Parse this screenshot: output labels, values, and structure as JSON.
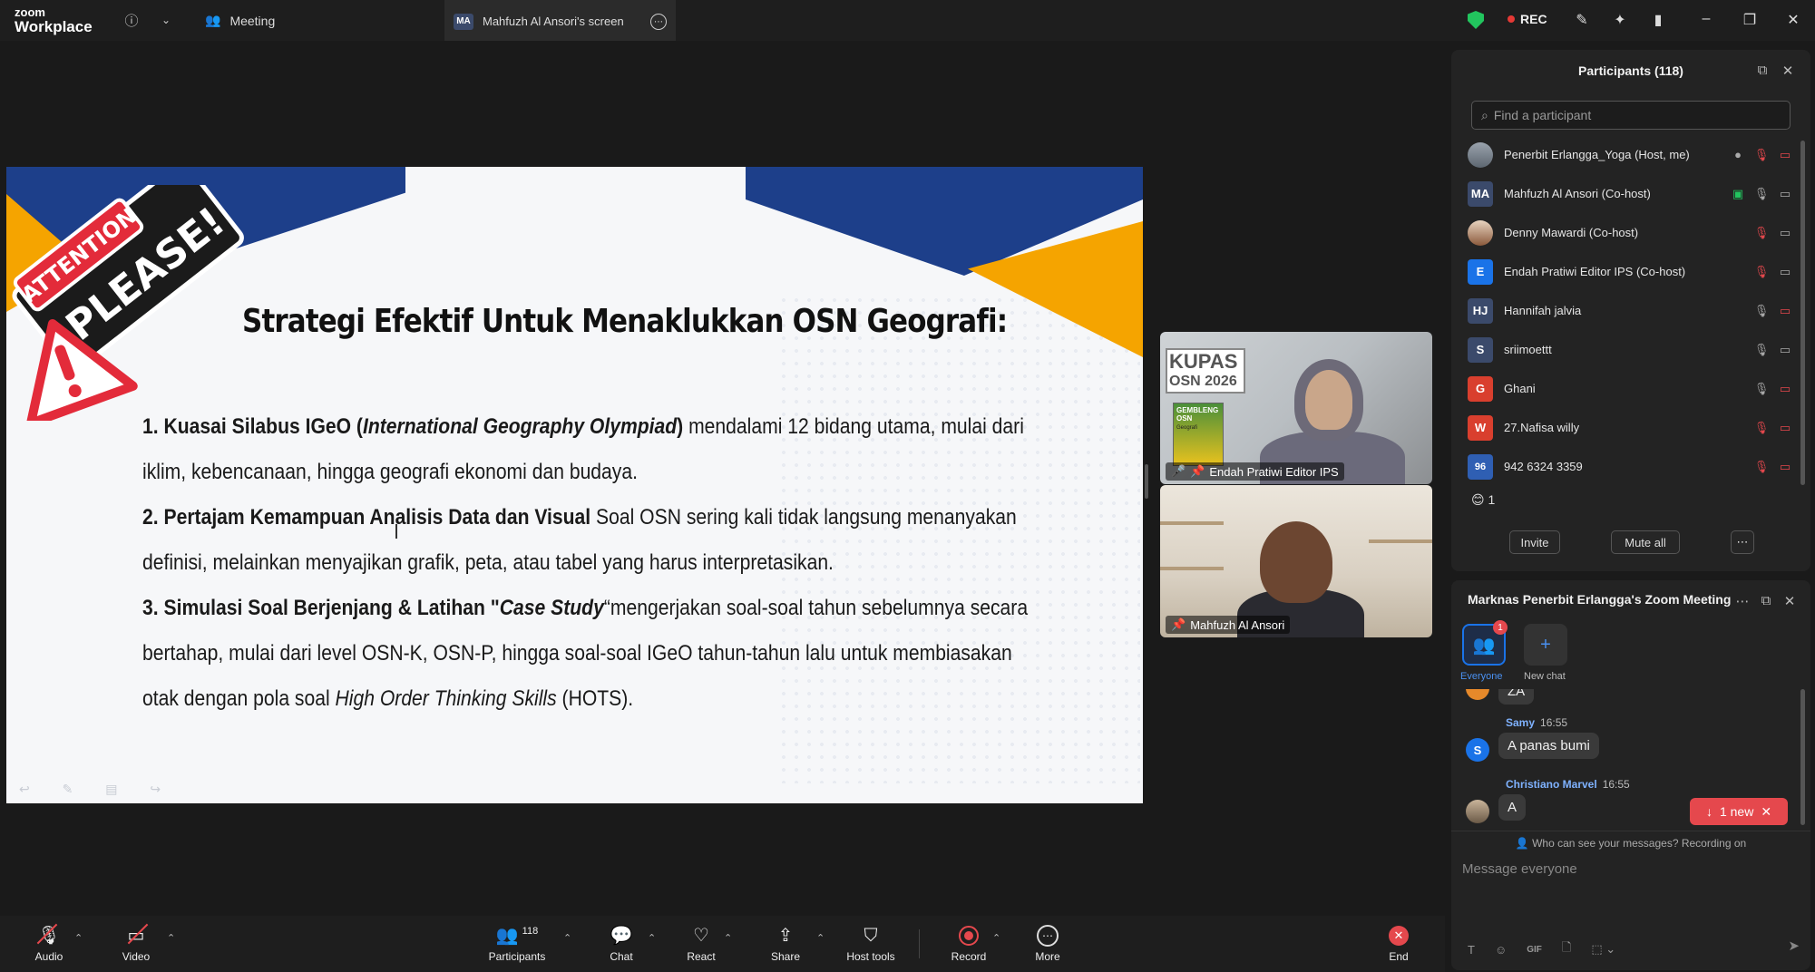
{
  "app": {
    "logo_line1": "zoom",
    "logo_line2": "Workplace"
  },
  "tabs": {
    "meeting": "Meeting",
    "screen_badge": "MA",
    "screen": "Mahfuzh Al Ansori's screen"
  },
  "status": {
    "rec": "REC"
  },
  "slide": {
    "attention_line1": "ATTENTION",
    "attention_line2": "PLEASE!",
    "title": "Strategi Efektif Untuk Menaklukkan OSN Geografi:",
    "items": [
      {
        "num": "1.",
        "bold": "Kuasai Silabus IGeO (",
        "italic_bold": "International Geography Olympiad",
        "bold_end": ")",
        "text": " mendalami 12 bidang utama, mulai dari iklim, kebencanaan, hingga geografi ekonomi dan budaya."
      },
      {
        "num": "2.",
        "bold": "Pertajam Kemampuan Analisis Data dan Visual",
        "text": " Soal OSN sering kali tidak langsung menanyakan definisi, melainkan menyajikan grafik, peta, atau tabel yang harus interpretasikan."
      },
      {
        "num": "3.",
        "bold": "Simulasi Soal Berjenjang & Latihan \"",
        "italic_bold": "Case Study",
        "text_pre": "“mengerjakan soal-soal tahun sebelumnya secara bertahap, mulai dari level OSN-K, OSN-P, hingga soal-soal IGeO tahun-tahun lalu untuk membiasakan otak dengan pola soal ",
        "italic": "High Order Thinking Skills",
        "text_post": " (HOTS)."
      }
    ]
  },
  "video_tiles": [
    {
      "name": "Endah Pratiwi Editor IPS",
      "overlay_title": "KUPAS",
      "overlay_sub": "OSN 2026",
      "book_label": "GEMBLENG OSN",
      "book_sub": "Geografi"
    },
    {
      "name": "Mahfuzh Al Ansori"
    }
  ],
  "participants": {
    "title": "Participants (118)",
    "search_placeholder": "Find a participant",
    "list": [
      {
        "initials": "",
        "name": "Penerbit Erlangga_Yoga (Host, me)",
        "color": ""
      },
      {
        "initials": "MA",
        "name": "Mahfuzh Al Ansori (Co-host)",
        "color": "#3b4a6b"
      },
      {
        "initials": "",
        "name": "Denny Mawardi (Co-host)",
        "color": ""
      },
      {
        "initials": "E",
        "name": "Endah Pratiwi Editor IPS (Co-host)",
        "color": "#1a73e8"
      },
      {
        "initials": "HJ",
        "name": "Hannifah jalvia",
        "color": "#3b4a6b"
      },
      {
        "initials": "S",
        "name": "sriimoettt",
        "color": "#3b4a6b"
      },
      {
        "initials": "G",
        "name": "Ghani",
        "color": "#d93f2e"
      },
      {
        "initials": "W",
        "name": "27.Nafisa willy",
        "color": "#d93f2e"
      },
      {
        "initials": "96",
        "name": "942 6324 3359",
        "color": "#2f5fb3"
      }
    ],
    "reaction_count": "1",
    "invite": "Invite",
    "mute_all": "Mute all"
  },
  "chat": {
    "title": "Marknas Penerbit Erlangga's Zoom Meeting",
    "tab_everyone": "Everyone",
    "tab_new_chat": "New chat",
    "unread": "1",
    "partial_top": "ZA",
    "messages": [
      {
        "initial": "S",
        "sender": "Samy",
        "time": "16:55",
        "text": "A panas bumi",
        "color": "#1a73e8"
      },
      {
        "initial": "",
        "sender": "Christiano Marvel",
        "time": "16:55",
        "text": "A",
        "color": ""
      }
    ],
    "new_pill": "1 new",
    "privacy": "Who can see your messages? Recording on",
    "compose_placeholder": "Message everyone",
    "gif": "GIF"
  },
  "toolbar": {
    "audio": "Audio",
    "video": "Video",
    "participants": "Participants",
    "participants_count": "118",
    "chat": "Chat",
    "react": "React",
    "share": "Share",
    "host_tools": "Host tools",
    "record": "Record",
    "more": "More",
    "end": "End"
  },
  "colors": {
    "accent": "#1a73e8",
    "danger": "#e5484d",
    "secure": "#22c55e",
    "slide_navy": "#1d3f8a",
    "slide_orange": "#f5a400"
  }
}
